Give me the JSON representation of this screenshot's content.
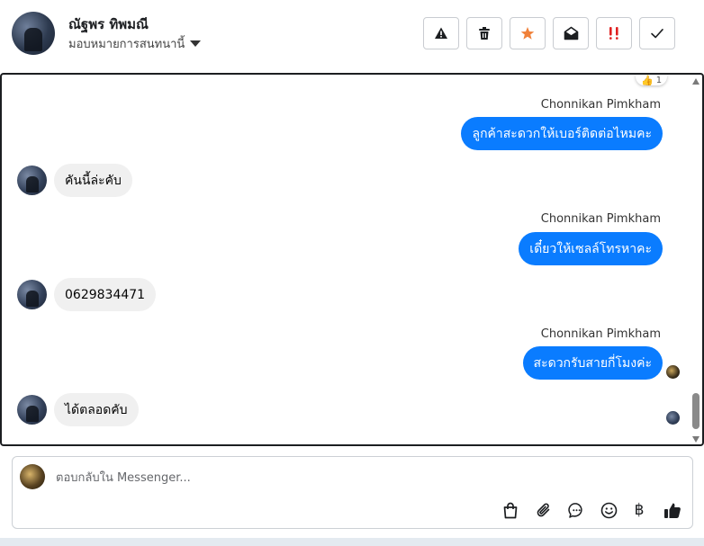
{
  "header": {
    "contact_name": "ณัฐพร ทิพมณี",
    "assign_label": "มอบหมายการสนทนานี้",
    "tools": [
      {
        "icon": "warning-icon",
        "color": "#1c1e21"
      },
      {
        "icon": "trash-icon",
        "color": "#1c1e21"
      },
      {
        "icon": "star-icon",
        "color": "#f0813a"
      },
      {
        "icon": "envelope-open-icon",
        "color": "#1c1e21"
      },
      {
        "icon": "priority-icon",
        "color": "#e02020"
      },
      {
        "icon": "check-icon",
        "color": "#1c1e21"
      }
    ]
  },
  "conversation": {
    "reaction": {
      "emoji": "👍",
      "count": "1"
    },
    "messages": [
      {
        "direction": "out",
        "sender": "Chonnikan Pimkham",
        "text": "ลูกค้าสะดวกให้เบอร์ติดต่อไหมคะ"
      },
      {
        "direction": "in",
        "text": "คันนี้ล่ะคับ"
      },
      {
        "direction": "out",
        "sender": "Chonnikan Pimkham",
        "text": "เดี๋ยวให้เซลล์โทรหาคะ"
      },
      {
        "direction": "in",
        "text": "0629834471"
      },
      {
        "direction": "out",
        "sender": "Chonnikan Pimkham",
        "text": "สะดวกรับสายกี่โมงค่ะ"
      },
      {
        "direction": "in",
        "text": "ได้ตลอดคับ"
      }
    ]
  },
  "composer": {
    "placeholder": "ตอบกลับใน Messenger...",
    "actions": [
      {
        "icon": "shopping-bag-icon"
      },
      {
        "icon": "paperclip-icon"
      },
      {
        "icon": "saved-reply-icon"
      },
      {
        "icon": "emoji-icon"
      },
      {
        "icon": "baht-icon",
        "glyph": "฿"
      },
      {
        "icon": "thumbs-up-icon"
      }
    ]
  },
  "colors": {
    "accent": "#0a7cff",
    "incoming_bubble": "#f0f0f0"
  }
}
